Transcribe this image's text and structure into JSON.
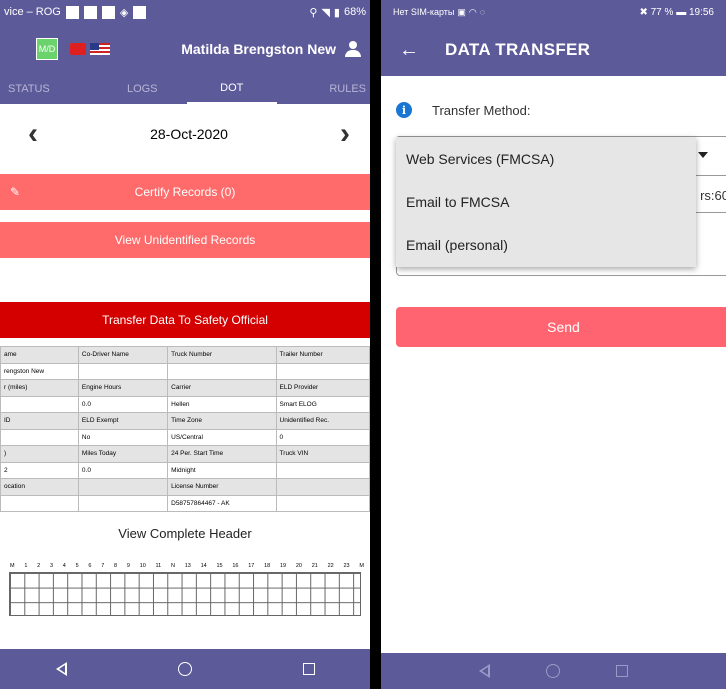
{
  "left": {
    "status": {
      "carrier": "vice – ROG",
      "battery": "68%"
    },
    "header": {
      "logo": "M/D",
      "driver_name": "Matilda Brengston New"
    },
    "tabs": [
      "STATUS",
      "LOGS",
      "DOT",
      "RULES"
    ],
    "date": "28-Oct-2020",
    "buttons": {
      "certify": "Certify Records (0)",
      "unidentified": "View Unidentified Records",
      "transfer": "Transfer Data To Safety Official"
    },
    "table": {
      "rows": [
        [
          "ame",
          "Co-Driver Name",
          "Truck Number",
          "Trailer Number"
        ],
        [
          "rengston New",
          "",
          "",
          ""
        ],
        [
          "r (miles)",
          "Engine Hours",
          "Carrier",
          "ELD Provider"
        ],
        [
          "",
          "0.0",
          "Hellen",
          "Smart ELOG"
        ],
        [
          "ID",
          "ELD Exempt",
          "Time Zone",
          "Unidentified Rec."
        ],
        [
          "",
          "No",
          "US/Central",
          "0"
        ],
        [
          ")",
          "Miles Today",
          "24 Per. Start Time",
          "Truck VIN"
        ],
        [
          "2",
          "0.0",
          "Midnight",
          ""
        ],
        [
          "ocation",
          "",
          "License Number",
          ""
        ],
        [
          "",
          "",
          "D58757864467 - AK",
          ""
        ]
      ]
    },
    "view_complete_header": "View Complete Header",
    "grid_labels": [
      "M",
      "1",
      "2",
      "3",
      "4",
      "5",
      "6",
      "7",
      "8",
      "9",
      "10",
      "11",
      "N",
      "13",
      "14",
      "15",
      "16",
      "17",
      "18",
      "19",
      "20",
      "21",
      "22",
      "23",
      "M"
    ]
  },
  "right": {
    "status": {
      "carrier": "Нет SIM-карты",
      "battery": "77 %",
      "time": "19:56"
    },
    "title": "DATA TRANSFER",
    "transfer_method_label": "Transfer Method:",
    "dropdown_options": [
      "Web Services (FMCSA)",
      "Email to FMCSA",
      "Email (personal)"
    ],
    "hidden_hrs_text": "rs:60",
    "send_label": "Send"
  }
}
